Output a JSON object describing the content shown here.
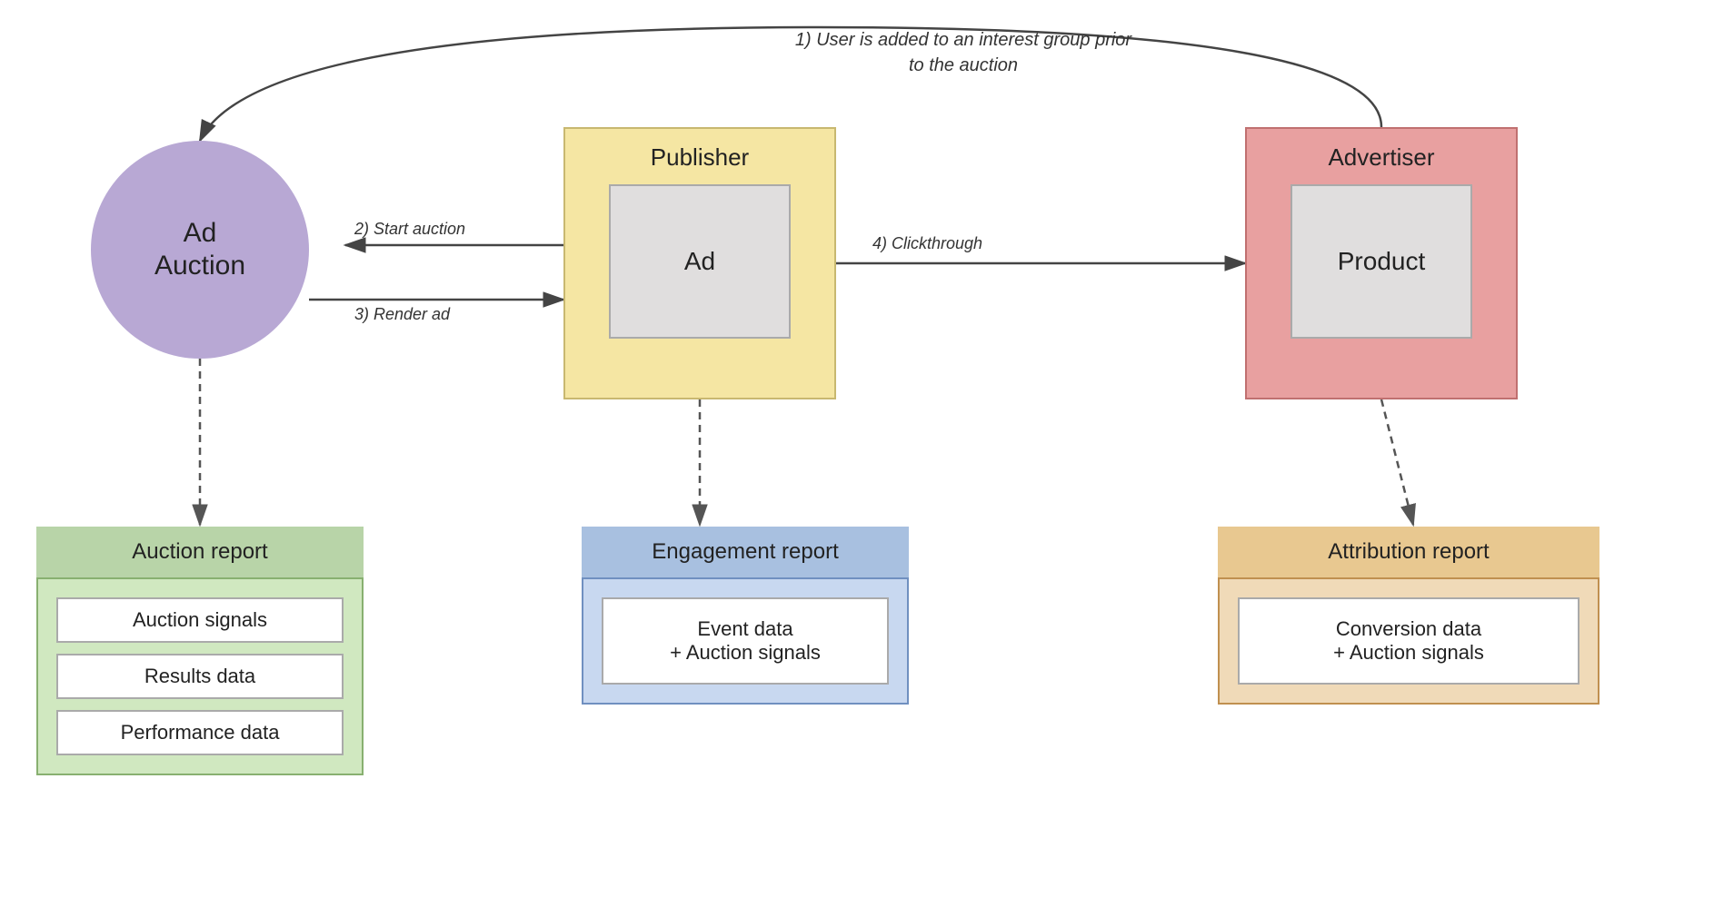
{
  "interest_note": "1) User is added to an interest group prior to the auction",
  "ad_auction": {
    "label": "Ad\nAuction"
  },
  "publisher": {
    "title": "Publisher",
    "inner_label": "Ad"
  },
  "advertiser": {
    "title": "Advertiser",
    "inner_label": "Product"
  },
  "arrows": {
    "start_auction": "2) Start auction",
    "render_ad": "3) Render ad",
    "clickthrough": "4) Clickthrough"
  },
  "auction_report": {
    "title": "Auction report",
    "items": [
      "Auction signals",
      "Results data",
      "Performance data"
    ]
  },
  "engagement_report": {
    "title": "Engagement report",
    "items": [
      "Event data\n+ Auction signals"
    ]
  },
  "attribution_report": {
    "title": "Attribution report",
    "items": [
      "Conversion data\n+ Auction signals"
    ]
  }
}
